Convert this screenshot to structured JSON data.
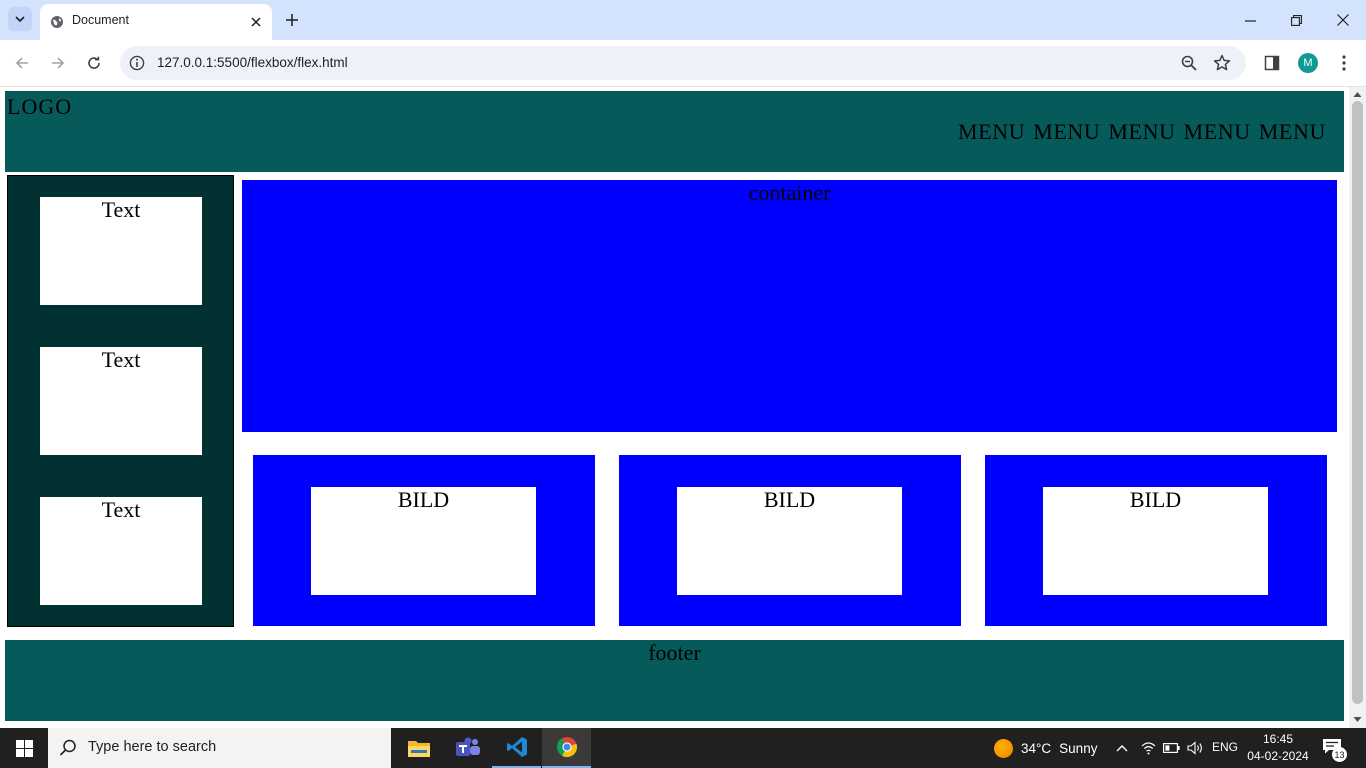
{
  "browser": {
    "tab": {
      "title": "Document"
    },
    "address": {
      "url": "127.0.0.1:5500/flexbox/flex.html"
    },
    "profile_initial": "M"
  },
  "page": {
    "header": {
      "logo": "LOGO",
      "menu": [
        "MENU",
        "MENU",
        "MENU",
        "MENU",
        "MENU"
      ]
    },
    "sidebar": {
      "items": [
        {
          "label": "Text"
        },
        {
          "label": "Text"
        },
        {
          "label": "Text"
        }
      ]
    },
    "container": {
      "label": "container"
    },
    "cards": [
      {
        "label": "BILD"
      },
      {
        "label": "BILD"
      },
      {
        "label": "BILD"
      }
    ],
    "footer": {
      "label": "footer"
    },
    "colors": {
      "header_bg": "#075a5a",
      "sidebar_bg": "#013131",
      "box_blue": "#0000ff",
      "box_white": "#ffffff"
    }
  },
  "taskbar": {
    "search_placeholder": "Type here to search",
    "apps": [
      "file-explorer",
      "teams",
      "vscode",
      "chrome"
    ],
    "weather": {
      "temp": "34°C",
      "condition": "Sunny"
    },
    "language": "ENG",
    "clock": {
      "time": "16:45",
      "date": "04-02-2024"
    },
    "notification_count": "13"
  }
}
